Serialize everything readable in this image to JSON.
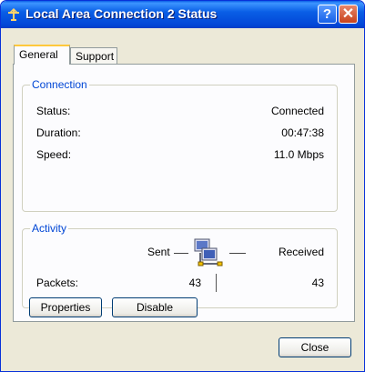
{
  "window": {
    "title": "Local Area Connection 2 Status",
    "help_glyph": "?",
    "close_glyph": "✕"
  },
  "tabs": [
    {
      "label": "General"
    },
    {
      "label": "Support"
    }
  ],
  "connection": {
    "legend": "Connection",
    "rows": [
      {
        "label": "Status:",
        "value": "Connected"
      },
      {
        "label": "Duration:",
        "value": "00:47:38"
      },
      {
        "label": "Speed:",
        "value": "11.0 Mbps"
      }
    ]
  },
  "activity": {
    "legend": "Activity",
    "sent_label": "Sent",
    "received_label": "Received",
    "packets_label": "Packets:",
    "packets_sent": "43",
    "packets_received": "43"
  },
  "buttons": {
    "properties": "Properties",
    "disable": "Disable",
    "close": "Close"
  }
}
